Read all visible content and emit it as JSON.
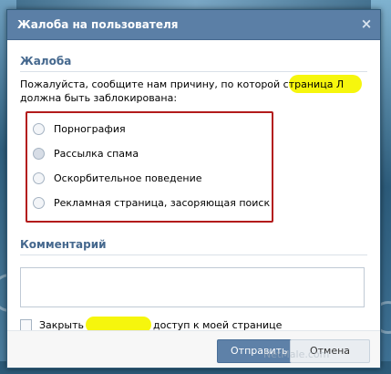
{
  "dialog": {
    "title": "Жалоба на пользователя",
    "close_glyph": "×"
  },
  "complaint": {
    "section_title": "Жалоба",
    "description_line1": "Пожалуйста, сообщите нам причину, по которой страница Л",
    "description_line2": "должна быть заблокирована:",
    "reasons": [
      {
        "label": "Порнография"
      },
      {
        "label": "Рассылка спама"
      },
      {
        "label": "Оскорбительное поведение"
      },
      {
        "label": "Рекламная страница, засоряющая поиск"
      }
    ],
    "reasons_border_color": "#b31b1b"
  },
  "comment": {
    "title": "Комментарий",
    "value": ""
  },
  "restrict": {
    "label_start": "Закрыть",
    "label_end": "доступ к моей странице"
  },
  "buttons": {
    "submit": "Отправить",
    "cancel": "Отмена"
  },
  "watermark": "NetMale.com",
  "colors": {
    "titlebar": "#5b7fa6",
    "section_title": "#45688e",
    "highlight": "#f5f500"
  }
}
